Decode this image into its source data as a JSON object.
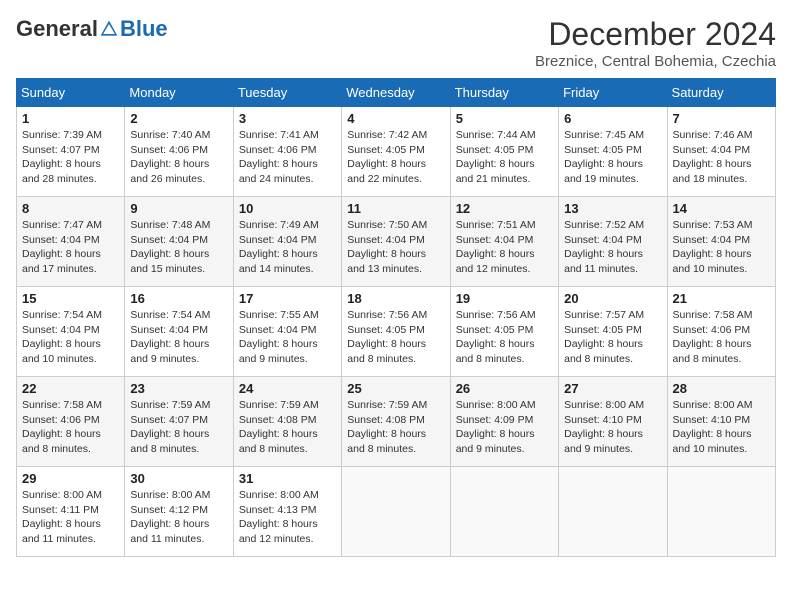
{
  "header": {
    "logo": {
      "general": "General",
      "blue": "Blue"
    },
    "title": "December 2024",
    "location": "Breznice, Central Bohemia, Czechia"
  },
  "weekdays": [
    "Sunday",
    "Monday",
    "Tuesday",
    "Wednesday",
    "Thursday",
    "Friday",
    "Saturday"
  ],
  "weeks": [
    [
      {
        "day": 1,
        "sunrise": "7:39 AM",
        "sunset": "4:07 PM",
        "daylight": "8 hours and 28 minutes."
      },
      {
        "day": 2,
        "sunrise": "7:40 AM",
        "sunset": "4:06 PM",
        "daylight": "8 hours and 26 minutes."
      },
      {
        "day": 3,
        "sunrise": "7:41 AM",
        "sunset": "4:06 PM",
        "daylight": "8 hours and 24 minutes."
      },
      {
        "day": 4,
        "sunrise": "7:42 AM",
        "sunset": "4:05 PM",
        "daylight": "8 hours and 22 minutes."
      },
      {
        "day": 5,
        "sunrise": "7:44 AM",
        "sunset": "4:05 PM",
        "daylight": "8 hours and 21 minutes."
      },
      {
        "day": 6,
        "sunrise": "7:45 AM",
        "sunset": "4:05 PM",
        "daylight": "8 hours and 19 minutes."
      },
      {
        "day": 7,
        "sunrise": "7:46 AM",
        "sunset": "4:04 PM",
        "daylight": "8 hours and 18 minutes."
      }
    ],
    [
      {
        "day": 8,
        "sunrise": "7:47 AM",
        "sunset": "4:04 PM",
        "daylight": "8 hours and 17 minutes."
      },
      {
        "day": 9,
        "sunrise": "7:48 AM",
        "sunset": "4:04 PM",
        "daylight": "8 hours and 15 minutes."
      },
      {
        "day": 10,
        "sunrise": "7:49 AM",
        "sunset": "4:04 PM",
        "daylight": "8 hours and 14 minutes."
      },
      {
        "day": 11,
        "sunrise": "7:50 AM",
        "sunset": "4:04 PM",
        "daylight": "8 hours and 13 minutes."
      },
      {
        "day": 12,
        "sunrise": "7:51 AM",
        "sunset": "4:04 PM",
        "daylight": "8 hours and 12 minutes."
      },
      {
        "day": 13,
        "sunrise": "7:52 AM",
        "sunset": "4:04 PM",
        "daylight": "8 hours and 11 minutes."
      },
      {
        "day": 14,
        "sunrise": "7:53 AM",
        "sunset": "4:04 PM",
        "daylight": "8 hours and 10 minutes."
      }
    ],
    [
      {
        "day": 15,
        "sunrise": "7:54 AM",
        "sunset": "4:04 PM",
        "daylight": "8 hours and 10 minutes."
      },
      {
        "day": 16,
        "sunrise": "7:54 AM",
        "sunset": "4:04 PM",
        "daylight": "8 hours and 9 minutes."
      },
      {
        "day": 17,
        "sunrise": "7:55 AM",
        "sunset": "4:04 PM",
        "daylight": "8 hours and 9 minutes."
      },
      {
        "day": 18,
        "sunrise": "7:56 AM",
        "sunset": "4:05 PM",
        "daylight": "8 hours and 8 minutes."
      },
      {
        "day": 19,
        "sunrise": "7:56 AM",
        "sunset": "4:05 PM",
        "daylight": "8 hours and 8 minutes."
      },
      {
        "day": 20,
        "sunrise": "7:57 AM",
        "sunset": "4:05 PM",
        "daylight": "8 hours and 8 minutes."
      },
      {
        "day": 21,
        "sunrise": "7:58 AM",
        "sunset": "4:06 PM",
        "daylight": "8 hours and 8 minutes."
      }
    ],
    [
      {
        "day": 22,
        "sunrise": "7:58 AM",
        "sunset": "4:06 PM",
        "daylight": "8 hours and 8 minutes."
      },
      {
        "day": 23,
        "sunrise": "7:59 AM",
        "sunset": "4:07 PM",
        "daylight": "8 hours and 8 minutes."
      },
      {
        "day": 24,
        "sunrise": "7:59 AM",
        "sunset": "4:08 PM",
        "daylight": "8 hours and 8 minutes."
      },
      {
        "day": 25,
        "sunrise": "7:59 AM",
        "sunset": "4:08 PM",
        "daylight": "8 hours and 8 minutes."
      },
      {
        "day": 26,
        "sunrise": "8:00 AM",
        "sunset": "4:09 PM",
        "daylight": "8 hours and 9 minutes."
      },
      {
        "day": 27,
        "sunrise": "8:00 AM",
        "sunset": "4:10 PM",
        "daylight": "8 hours and 9 minutes."
      },
      {
        "day": 28,
        "sunrise": "8:00 AM",
        "sunset": "4:10 PM",
        "daylight": "8 hours and 10 minutes."
      }
    ],
    [
      {
        "day": 29,
        "sunrise": "8:00 AM",
        "sunset": "4:11 PM",
        "daylight": "8 hours and 11 minutes."
      },
      {
        "day": 30,
        "sunrise": "8:00 AM",
        "sunset": "4:12 PM",
        "daylight": "8 hours and 11 minutes."
      },
      {
        "day": 31,
        "sunrise": "8:00 AM",
        "sunset": "4:13 PM",
        "daylight": "8 hours and 12 minutes."
      },
      null,
      null,
      null,
      null
    ]
  ]
}
